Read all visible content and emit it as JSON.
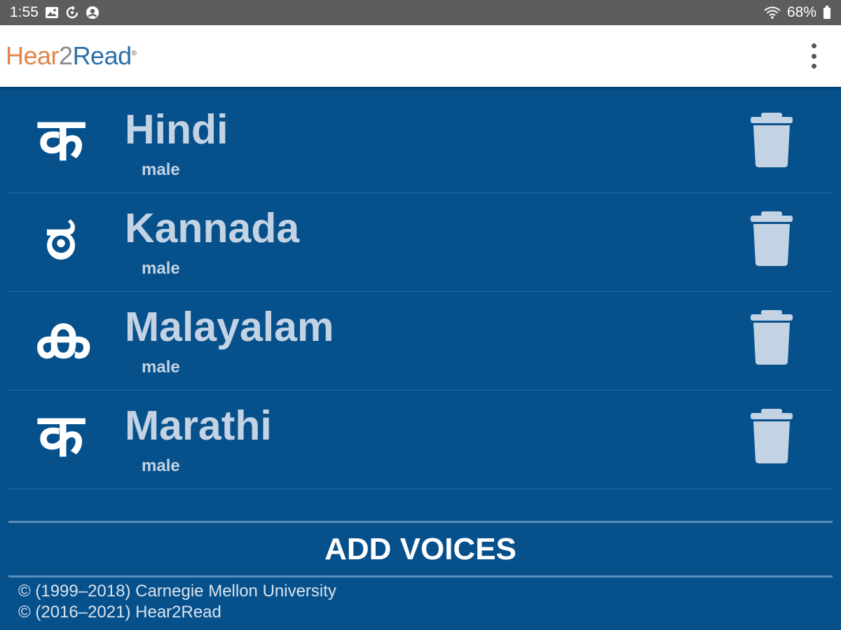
{
  "status_bar": {
    "time": "1:55",
    "battery": "68%",
    "left_icons": [
      "image-icon",
      "sync-icon",
      "account-icon"
    ],
    "right_icons": [
      "wifi-icon",
      "battery-icon"
    ]
  },
  "app_bar": {
    "logo_parts": [
      "Hear",
      "2",
      "Read",
      "®"
    ],
    "menu_icon": "more-vert-icon"
  },
  "colors": {
    "background": "#06508c",
    "status_bar": "#5d5d5d",
    "voice_text": "#c3d3e3",
    "trash_icon": "#c3d3e3",
    "logo_orange": "#e08547",
    "logo_blue": "#2c6fa8"
  },
  "voices": [
    {
      "glyph": "क",
      "language": "Hindi",
      "gender": "male",
      "delete_icon": "trash-icon"
    },
    {
      "glyph": "ಠ",
      "language": "Kannada",
      "gender": "male",
      "delete_icon": "trash-icon"
    },
    {
      "glyph": "ക",
      "language": "Malayalam",
      "gender": "male",
      "delete_icon": "trash-icon"
    },
    {
      "glyph": "क",
      "language": "Marathi",
      "gender": "male",
      "delete_icon": "trash-icon"
    }
  ],
  "add_voices_label": "ADD VOICES",
  "footer": {
    "line1": "© (1999–2018) Carnegie Mellon University",
    "line2": "© (2016–2021) Hear2Read"
  }
}
